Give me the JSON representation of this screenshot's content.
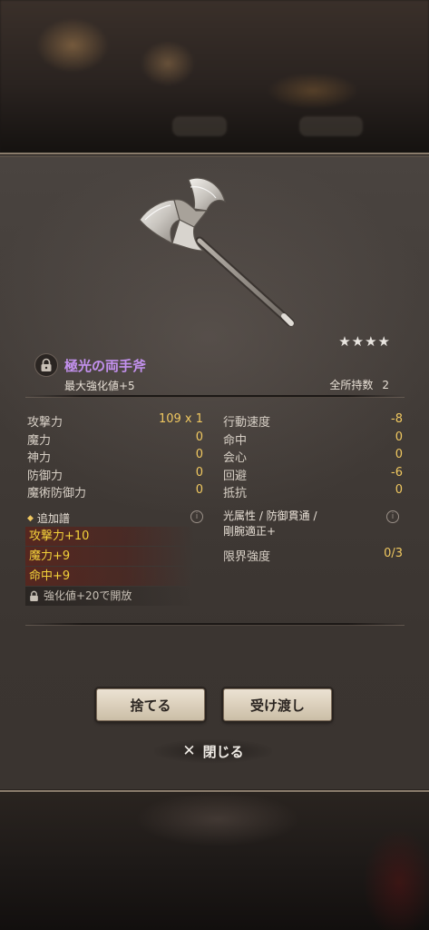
{
  "item": {
    "name": "極光の両手斧",
    "rarity_stars": "★★★★",
    "max_enhance": "最大強化値+5",
    "owned_label": "全所持数",
    "owned_count": "2"
  },
  "stats_left": [
    {
      "label": "攻撃力",
      "value": "109 x 1"
    },
    {
      "label": "魔力",
      "value": "0"
    },
    {
      "label": "神力",
      "value": "0"
    },
    {
      "label": "防御力",
      "value": "0"
    },
    {
      "label": "魔術防御力",
      "value": "0"
    }
  ],
  "stats_right": [
    {
      "label": "行動速度",
      "value": "-8"
    },
    {
      "label": "命中",
      "value": "0"
    },
    {
      "label": "会心",
      "value": "0"
    },
    {
      "label": "回避",
      "value": "-6"
    },
    {
      "label": "抵抗",
      "value": "0"
    }
  ],
  "bonus": {
    "title": "追加譜",
    "rows": [
      "攻撃力+10",
      "魔力+9",
      "命中+9"
    ],
    "unlock_text": "強化値+20で開放"
  },
  "traits": {
    "line1": "光属性 / 防御貫通 /",
    "line2": "剛腕適正+"
  },
  "limit": {
    "label": "限界強度",
    "value": "0/3"
  },
  "buttons": {
    "discard": "捨てる",
    "transfer": "受け渡し",
    "close": "閉じる"
  },
  "colors": {
    "item_name": "#c391ee",
    "bonus_text": "#f4d23a",
    "stat_value": "#f0c860"
  }
}
